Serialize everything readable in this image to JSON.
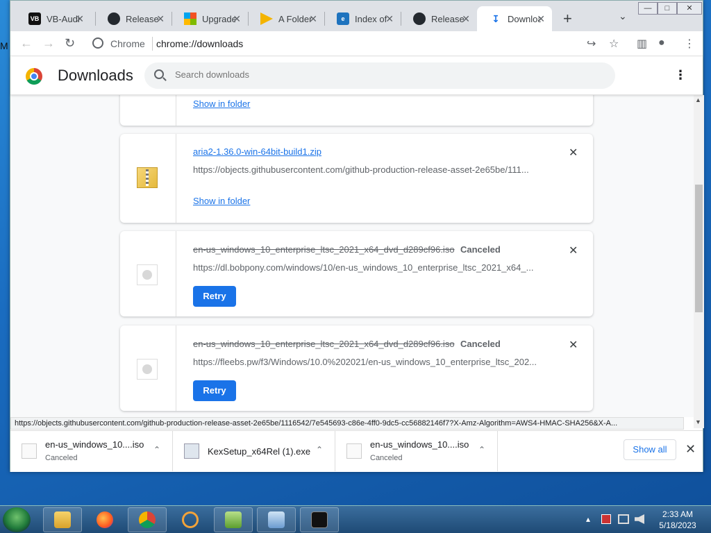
{
  "desktop": {
    "edge_letter": "M"
  },
  "window_controls": {
    "minimize": "—",
    "maximize": "□",
    "close": "✕"
  },
  "tabs": [
    {
      "title": "VB-Audio",
      "icon": "vb-audio-icon",
      "color": "#111111"
    },
    {
      "title": "Releases",
      "icon": "github-icon",
      "color": "#24292f"
    },
    {
      "title": "Upgrade",
      "icon": "microsoft-icon",
      "color": "#f25022"
    },
    {
      "title": "A Folder",
      "icon": "folder-arrow-icon",
      "color": "#f4b400"
    },
    {
      "title": "Index of",
      "icon": "ie-icon",
      "color": "#1e73be"
    },
    {
      "title": "Release",
      "icon": "github-icon",
      "color": "#24292f"
    },
    {
      "title": "Downloads",
      "icon": "download-icon",
      "color": "#1a73e8"
    }
  ],
  "tab_close": "✕",
  "new_tab": "+",
  "tab_search": "⌄",
  "nav": {
    "back": "←",
    "forward": "→",
    "reload": "↻"
  },
  "omnibox": {
    "scheme": "Chrome",
    "url": "chrome://downloads"
  },
  "toolbar_icons": {
    "share": "↪",
    "bookmark": "☆",
    "sidepanel": "▥",
    "profile": "●",
    "menu": "⋮"
  },
  "page": {
    "title": "Downloads",
    "search_placeholder": "Search downloads",
    "menu": "⋮"
  },
  "downloads": [
    {
      "action": "Show in folder"
    },
    {
      "filename": "aria2-1.36.0-win-64bit-build1.zip",
      "url": "https://objects.githubusercontent.com/github-production-release-asset-2e65be/111...",
      "action": "Show in folder",
      "remove": "✕"
    },
    {
      "filename": "en-us_windows_10_enterprise_ltsc_2021_x64_dvd_d289cf96.iso",
      "status": "Canceled",
      "url": "https://dl.bobpony.com/windows/10/en-us_windows_10_enterprise_ltsc_2021_x64_...",
      "action": "Retry",
      "remove": "✕"
    },
    {
      "filename": "en-us_windows_10_enterprise_ltsc_2021_x64_dvd_d289cf96.iso",
      "status": "Canceled",
      "url": "https://fleebs.pw/f3/Windows/10.0%202021/en-us_windows_10_enterprise_ltsc_202...",
      "action": "Retry",
      "remove": "✕"
    }
  ],
  "status_url": "https://objects.githubusercontent.com/github-production-release-asset-2e65be/1116542/7e545693-c86e-4ff0-9dc5-cc56882146f7?X-Amz-Algorithm=AWS4-HMAC-SHA256&X-A...",
  "shelf": {
    "items": [
      {
        "name": "en-us_windows_10....iso",
        "status": "Canceled",
        "icon": "iso-file-icon"
      },
      {
        "name": "KexSetup_x64Rel (1).exe",
        "status": "",
        "icon": "exe-file-icon"
      },
      {
        "name": "en-us_windows_10....iso",
        "status": "Canceled",
        "icon": "iso-file-icon"
      }
    ],
    "chevron": "⌃",
    "show_all": "Show all",
    "close": "✕"
  },
  "taskbar": {
    "apps": [
      "explorer-icon",
      "firefox-icon",
      "chrome-icon",
      "search-tool-icon",
      "notepadpp-icon",
      "control-panel-icon",
      "cmd-icon"
    ],
    "tray": "▴",
    "time": "2:33 AM",
    "date": "5/18/2023"
  }
}
